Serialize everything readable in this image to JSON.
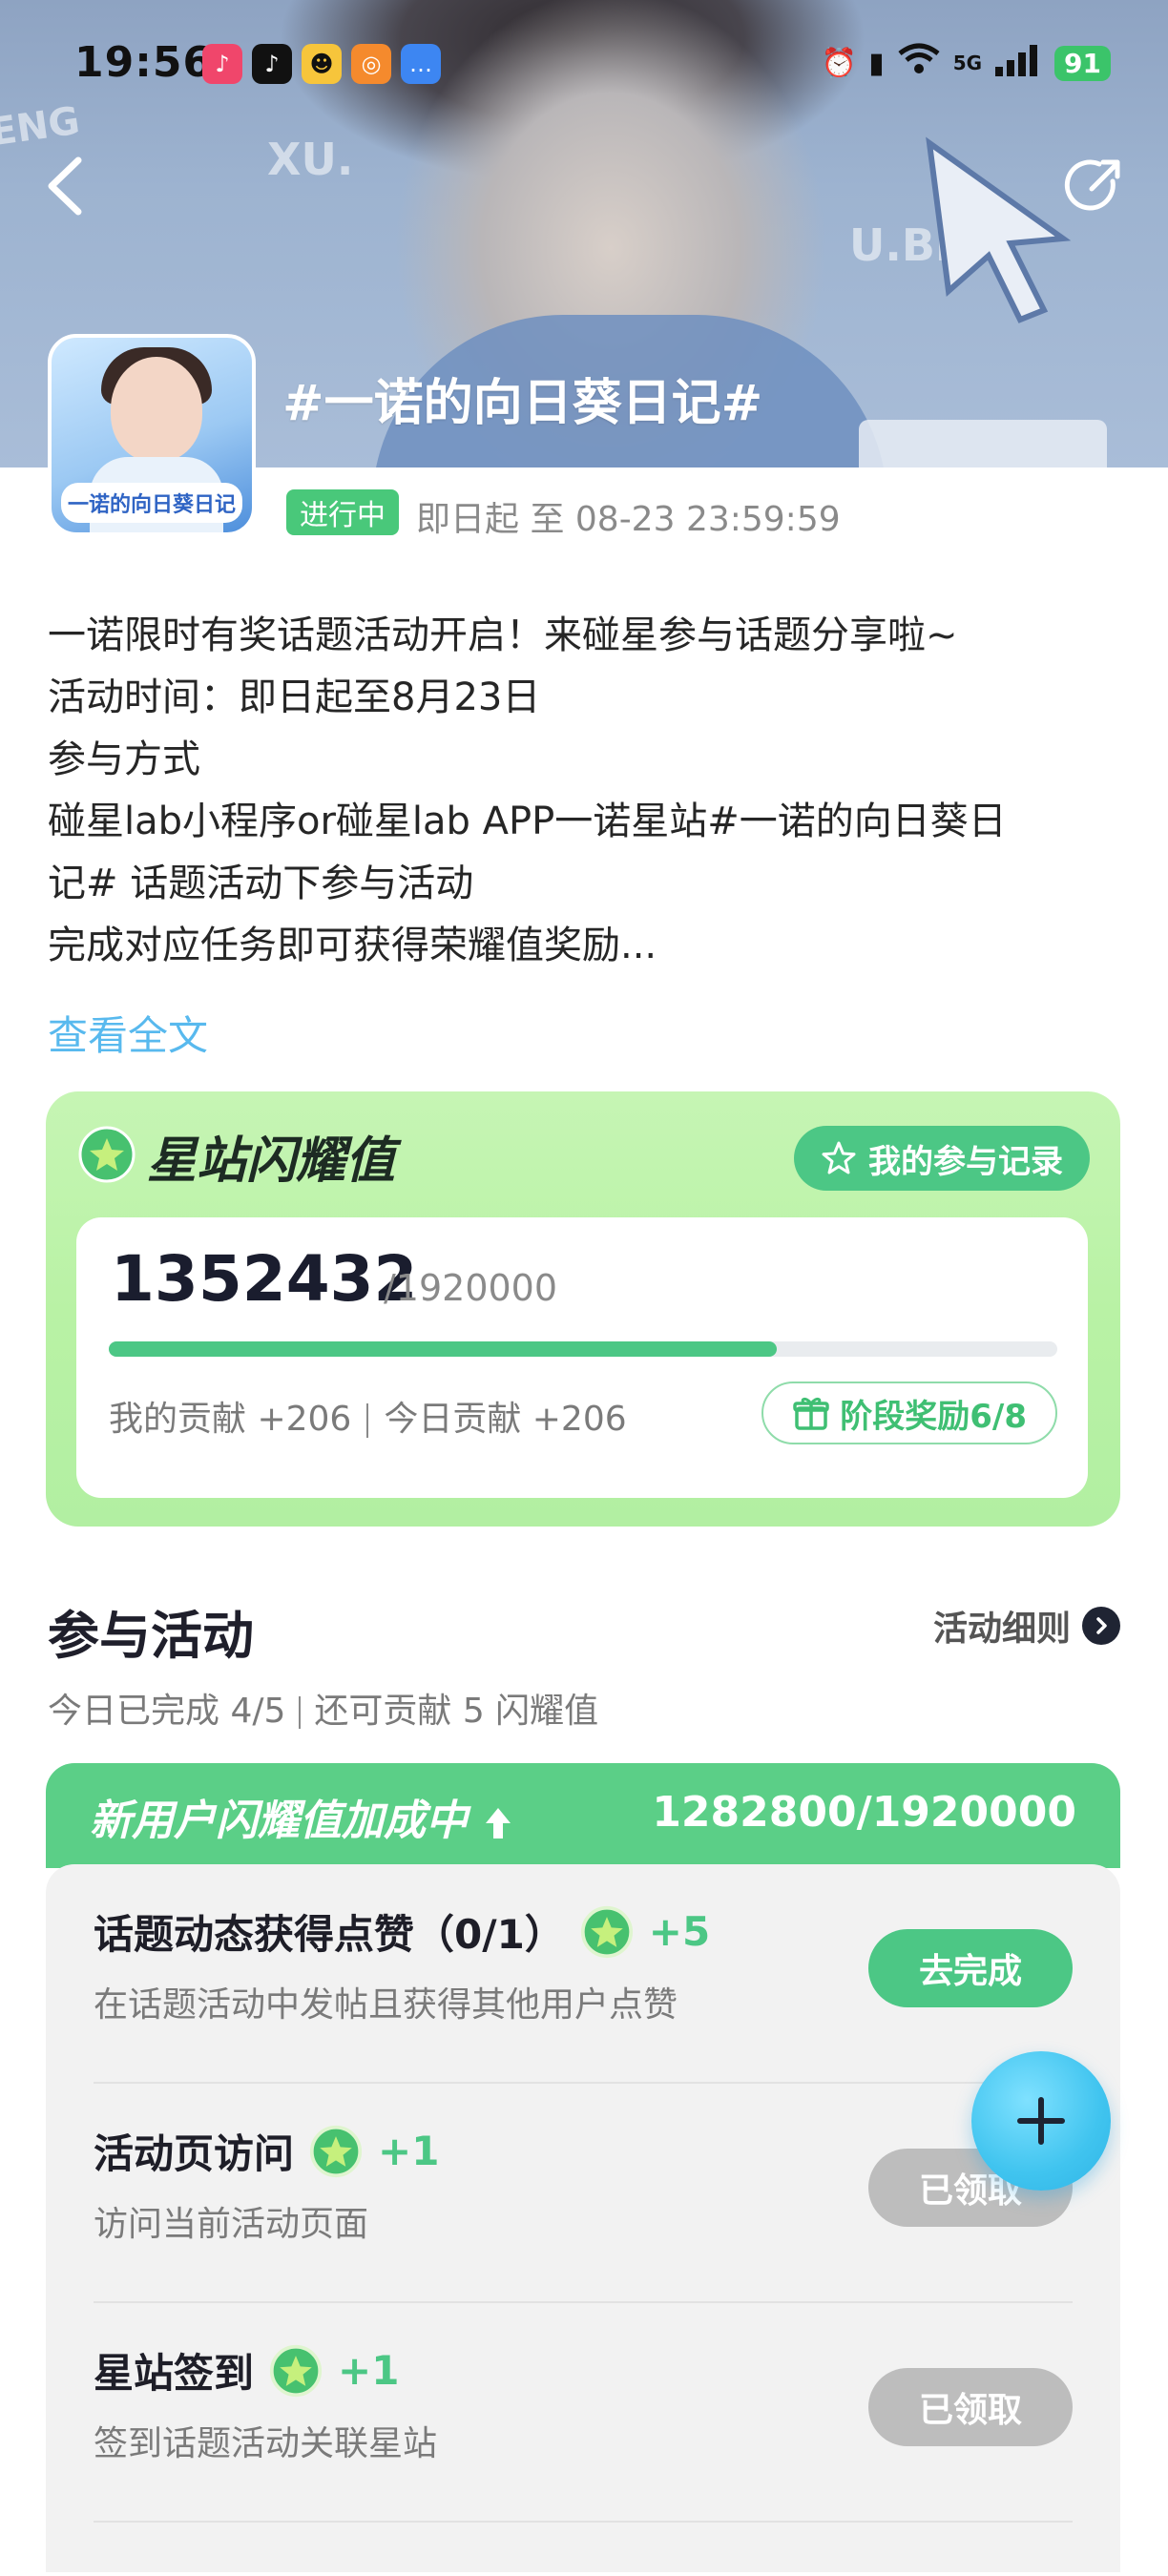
{
  "status_bar": {
    "time": "19:56",
    "network": "5G",
    "battery": "91"
  },
  "topic": {
    "title": "#一诺的向日葵日记#",
    "avatar_text": "一诺的向日葵日记",
    "status": "进行中",
    "date_range": "即日起 至 08-23 23:59:59"
  },
  "description": {
    "lines": [
      "一诺限时有奖话题活动开启！来碰星参与话题分享啦~",
      "活动时间：即日起至8月23日",
      "参与方式",
      "碰星lab小程序or碰星lab APP一诺星站#一诺的向日葵日",
      "记# 话题活动下参与活动",
      "完成对应任务即可获得荣耀值奖励..."
    ],
    "read_more": "查看全文"
  },
  "glory": {
    "title": "星站闪耀值",
    "record_button": "我的参与记录",
    "value": "1352432",
    "total": "/1920000",
    "progress": 0.704,
    "my_contribution": "我的贡献 +206",
    "today_contribution": "今日贡献 +206",
    "stage_button": "阶段奖励6/8"
  },
  "participate": {
    "title": "参与活动",
    "rules_link": "活动细则",
    "today_done": "今日已完成 4/5",
    "can_contribute": "还可贡献 5 闪耀值",
    "bonus_label": "新用户闪耀值加成中",
    "bonus_value": "1282800/1920000",
    "tasks": [
      {
        "title": "话题动态获得点赞（0/1）",
        "points": "+5",
        "desc": "在话题活动中发帖且获得其他用户点赞",
        "button": "去完成"
      },
      {
        "title": "活动页访问",
        "points": "+1",
        "desc": "访问当前活动页面",
        "button": "已领取"
      },
      {
        "title": "星站签到",
        "points": "+1",
        "desc": "签到话题活动关联星站",
        "button": "已领取"
      }
    ]
  },
  "colors": {
    "accent_green": "#4cc785",
    "link_blue": "#58b9ee",
    "card_green": "#c6f5b4",
    "done_gray": "#bdbdbd"
  },
  "icons": [
    "back-icon",
    "share-icon",
    "star-coin-icon",
    "star-outline-icon",
    "gift-icon",
    "chevron-right-icon",
    "plus-icon",
    "up-arrow-icon"
  ]
}
